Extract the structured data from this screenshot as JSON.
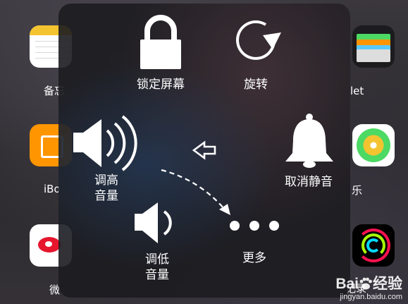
{
  "background_apps": {
    "notes_label": "备忘",
    "ibooks_label": "iBo",
    "weibo_label": "微",
    "wallet_label": "let",
    "music_label": "乐",
    "activity_label": "记录"
  },
  "assistive_touch": {
    "lock_label": "锁定屏幕",
    "rotate_label": "旋转",
    "volume_up_label_line1": "调高",
    "volume_up_label_line2": "音量",
    "mute_label": "取消静音",
    "volume_down_label_line1": "调低",
    "volume_down_label_line2": "音量",
    "more_label": "更多"
  },
  "watermark": {
    "brand_left": "Bai",
    "brand_right": "经验",
    "url": "jingyan.baidu.com"
  },
  "colors": {
    "panel_bg": "#1c1c20",
    "icon_white": "#ffffff",
    "notes_yellow": "#f4c430",
    "ibooks_orange": "#ff9500",
    "weibo_red": "#e6162d"
  }
}
